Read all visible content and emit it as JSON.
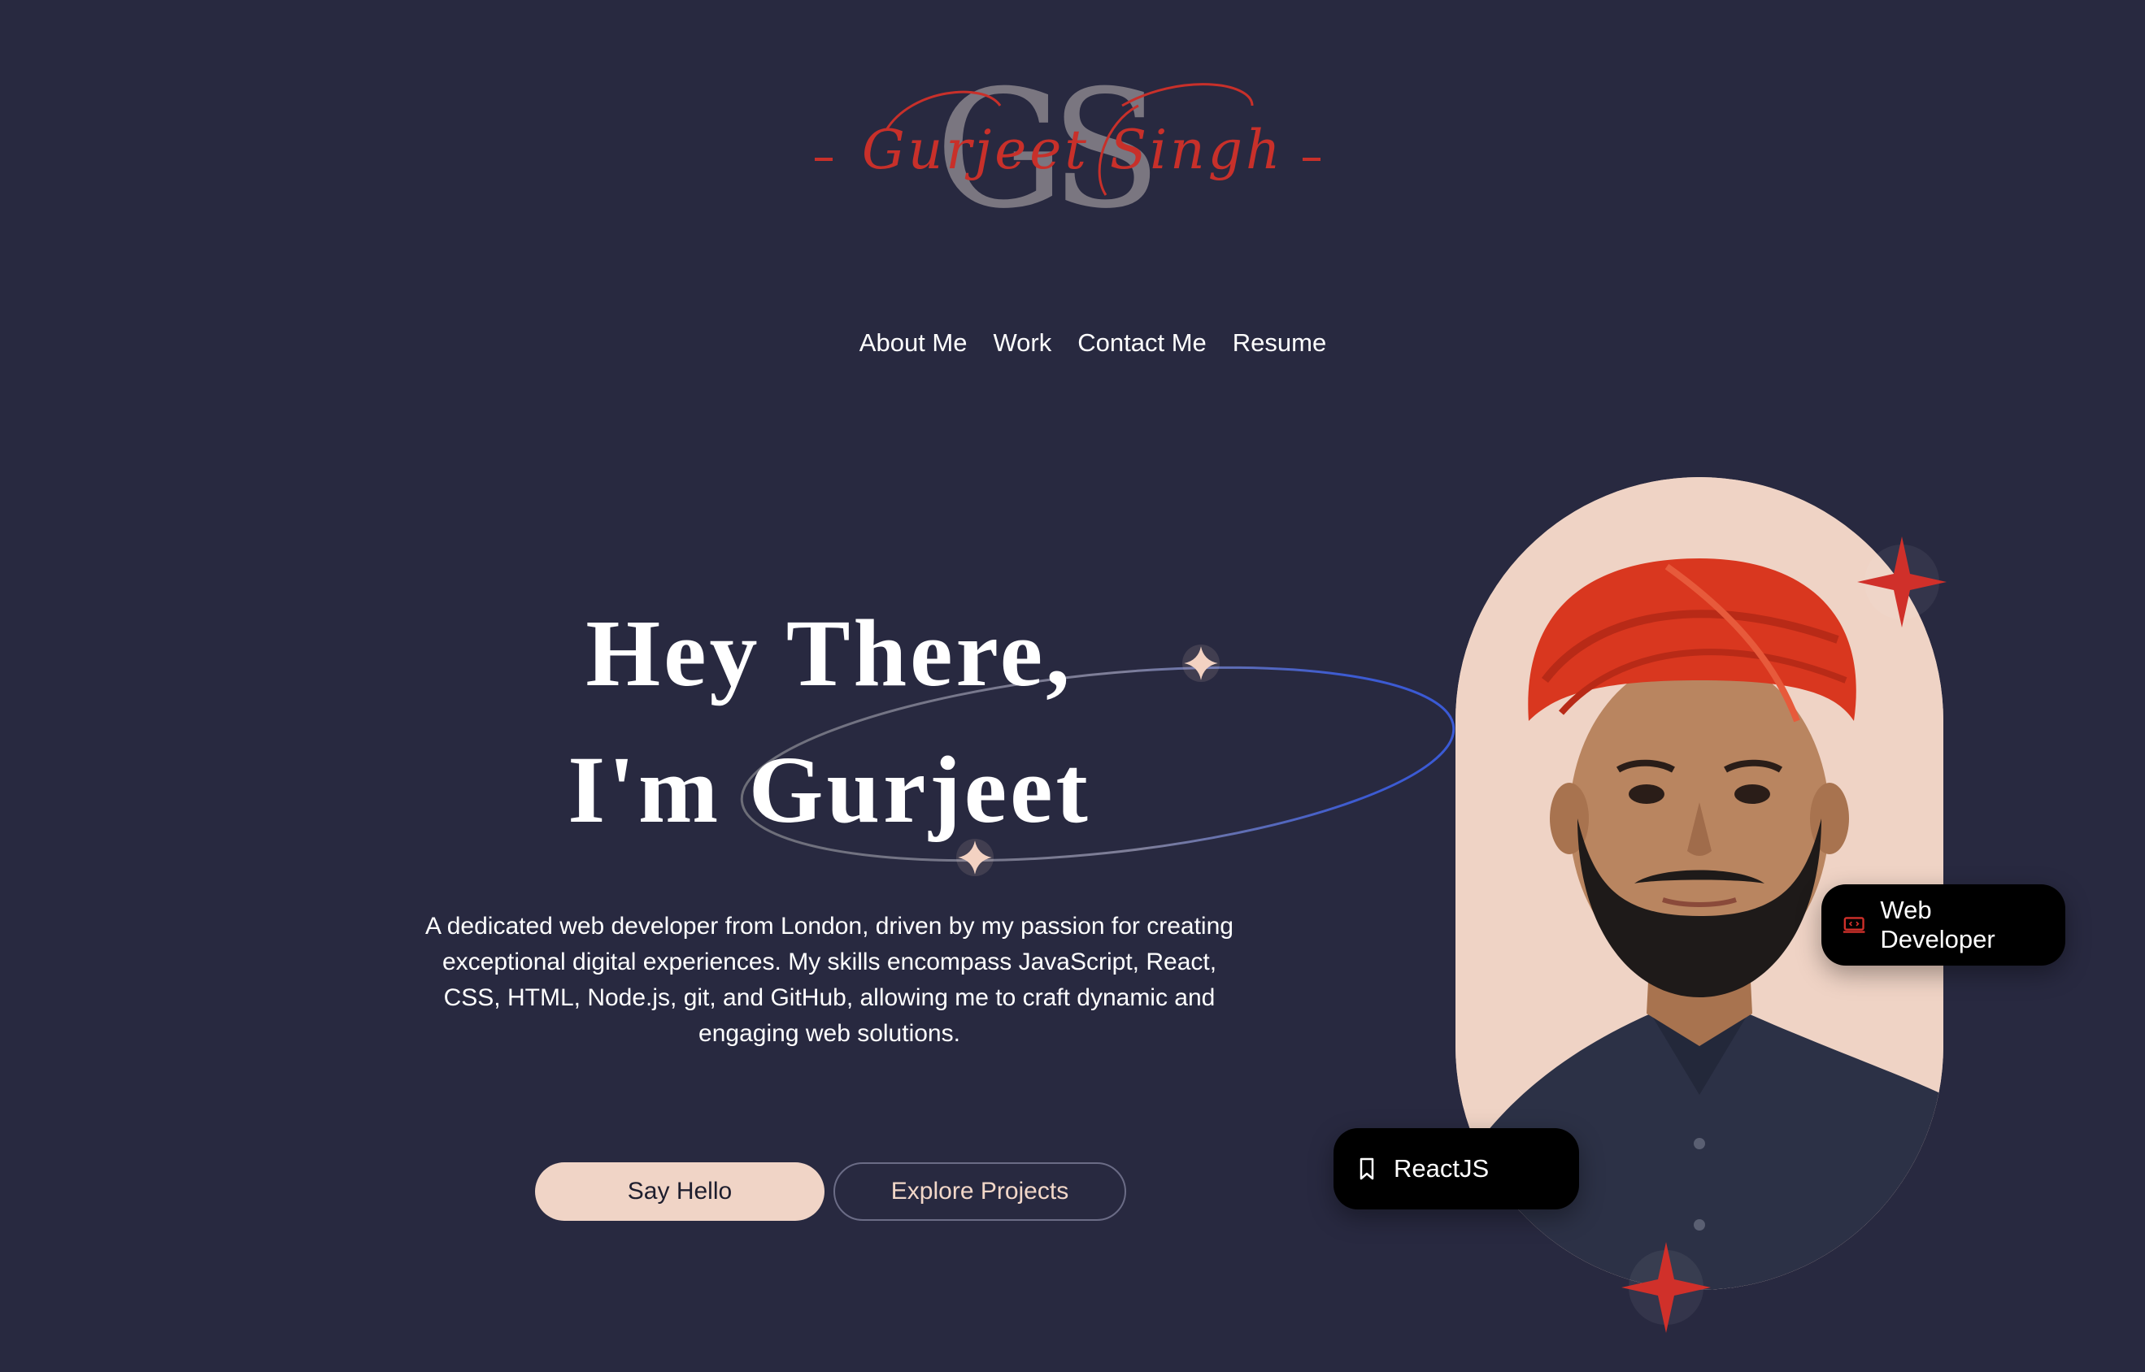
{
  "logo": {
    "monogram": "GS",
    "script_name": "Gurjeet Singh",
    "accent_color": "#c8302a"
  },
  "nav": {
    "items": [
      {
        "label": "About Me"
      },
      {
        "label": "Work"
      },
      {
        "label": "Contact Me"
      },
      {
        "label": "Resume"
      }
    ]
  },
  "hero": {
    "title_line1": "Hey There,",
    "title_line2": "I'm Gurjeet",
    "description": "A dedicated web developer from London, driven by my passion for creating exceptional digital experiences. My skills encompass JavaScript, React, CSS, HTML, Node.js, git, and GitHub, allowing me to craft dynamic and engaging web solutions.",
    "primary_button": "Say Hello",
    "secondary_button": "Explore Projects"
  },
  "portrait": {
    "chip_role": "Web Developer",
    "chip_role_icon": "laptop-code-icon",
    "chip_skill": "ReactJS",
    "chip_skill_icon": "bookmark-icon",
    "accent_color": "#d0302a",
    "background_color": "#efd3c5"
  },
  "theme": {
    "background": "#282940",
    "button_primary": "#f0d4c6",
    "sparkle": "#f3d2c2"
  }
}
